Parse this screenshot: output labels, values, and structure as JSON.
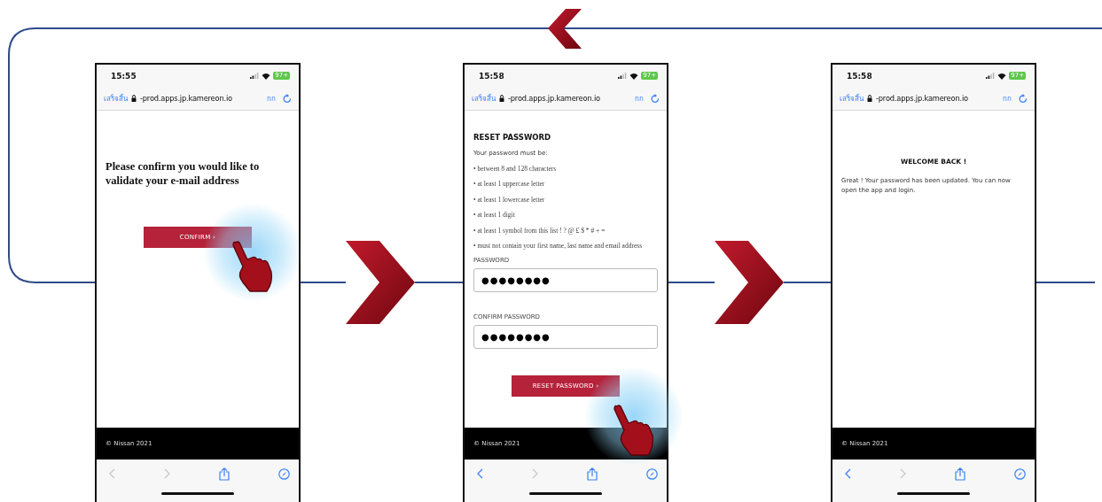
{
  "phones": [
    {
      "kind": "confirm",
      "touch": true,
      "time": "15:55",
      "battery": "97+",
      "browser": {
        "done": "เสร็จสิ้น",
        "address": "-prod.apps.jp.kamereon.io",
        "text_size": "กก"
      },
      "heading": "Please confirm you would like to validate your e-mail address",
      "button": "CONFIRM ›",
      "footer": "© Nissan 2021",
      "back_disabled": true,
      "forward_disabled": true
    },
    {
      "kind": "reset",
      "touch": true,
      "time": "15:58",
      "battery": "97+",
      "browser": {
        "done": "เสร็จสิ้น",
        "address": "-prod.apps.jp.kamereon.io",
        "text_size": "กก"
      },
      "title": "RESET PASSWORD",
      "intro": "Your password must be:",
      "rules": [
        "• between 8 and 128 characters",
        "• at least 1 uppercase letter",
        "• at least 1 lowercase letter",
        "• at least 1 digit",
        "• at least 1 symbol from this list ! ? @ £ $ * # + =",
        "• must not contain your first name, last name and email address"
      ],
      "fields": [
        {
          "label": "PASSWORD",
          "value": "●●●●●●●●"
        },
        {
          "label": "CONFIRM PASSWORD",
          "value": "●●●●●●●●"
        }
      ],
      "button": "RESET PASSWORD ›",
      "footer": "© Nissan 2021",
      "back_disabled": false,
      "forward_disabled": true
    },
    {
      "kind": "welcome",
      "touch": false,
      "time": "15:58",
      "battery": "97+",
      "browser": {
        "done": "เสร็จสิ้น",
        "address": "-prod.apps.jp.kamereon.io",
        "text_size": "กก"
      },
      "title": "WELCOME BACK !",
      "message": "Great ! Your password has been updated. You can now open the app and login.",
      "footer": "© Nissan 2021",
      "back_disabled": false,
      "forward_disabled": true
    }
  ]
}
